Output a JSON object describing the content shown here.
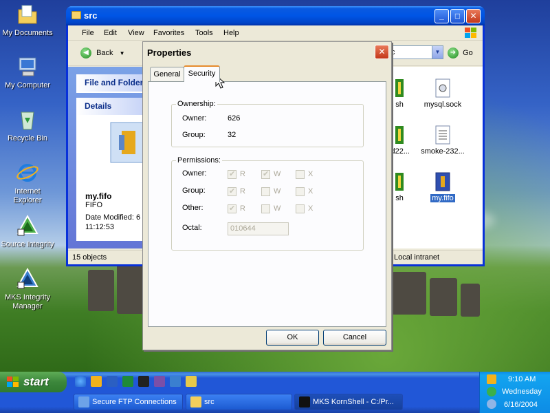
{
  "desktop": {
    "icons": [
      {
        "label": "My Documents"
      },
      {
        "label": "My Computer"
      },
      {
        "label": "Recycle Bin"
      },
      {
        "label": "Internet Explorer"
      },
      {
        "label": "Source Integrity"
      },
      {
        "label": "MKS Integrity Manager"
      }
    ]
  },
  "explorer": {
    "title": "src",
    "menu": [
      "File",
      "Edit",
      "View",
      "Favorites",
      "Tools",
      "Help"
    ],
    "back_label": "Back",
    "address_value": "c",
    "go_label": "Go",
    "sections": {
      "file_folder": "File and Folder",
      "details": "Details"
    },
    "details": {
      "name": "my.fifo",
      "type": "FIFO",
      "date_modified": "Date Modified: 6",
      "time": "11:12:53"
    },
    "files": [
      {
        "name": "sh"
      },
      {
        "name": "mysql.sock"
      },
      {
        "name": "ld22..."
      },
      {
        "name": "smoke-232..."
      },
      {
        "name": "sh"
      },
      {
        "name": "my.fifo",
        "selected": true
      }
    ],
    "status": {
      "objects": "15 objects",
      "zone": "Local intranet"
    }
  },
  "dialog": {
    "title": "Properties",
    "tabs": {
      "general": "General",
      "security": "Security"
    },
    "ownership": {
      "legend": "Ownership:",
      "owner_label": "Owner:",
      "owner_value": "626",
      "group_label": "Group:",
      "group_value": "32"
    },
    "permissions": {
      "legend": "Permissions:",
      "rows": [
        {
          "label": "Owner:",
          "r": true,
          "w": true,
          "x": false
        },
        {
          "label": "Group:",
          "r": true,
          "w": false,
          "x": false
        },
        {
          "label": "Other:",
          "r": true,
          "w": false,
          "x": false
        }
      ],
      "r_label": "R",
      "w_label": "W",
      "x_label": "X",
      "octal_label": "Octal:",
      "octal_value": "010644"
    },
    "ok_label": "OK",
    "cancel_label": "Cancel"
  },
  "taskbar": {
    "start_label": "start",
    "tasks": [
      {
        "label": "Secure FTP Connections"
      },
      {
        "label": "src"
      },
      {
        "label": "MKS KornShell - C:/Pr..."
      }
    ],
    "clock": {
      "time": "9:10 AM",
      "day": "Wednesday",
      "date": "6/16/2004"
    }
  },
  "colors": {
    "xp_blue": "#0055e5",
    "selection": "#316ac5",
    "tab_accent": "#e68b2c"
  }
}
